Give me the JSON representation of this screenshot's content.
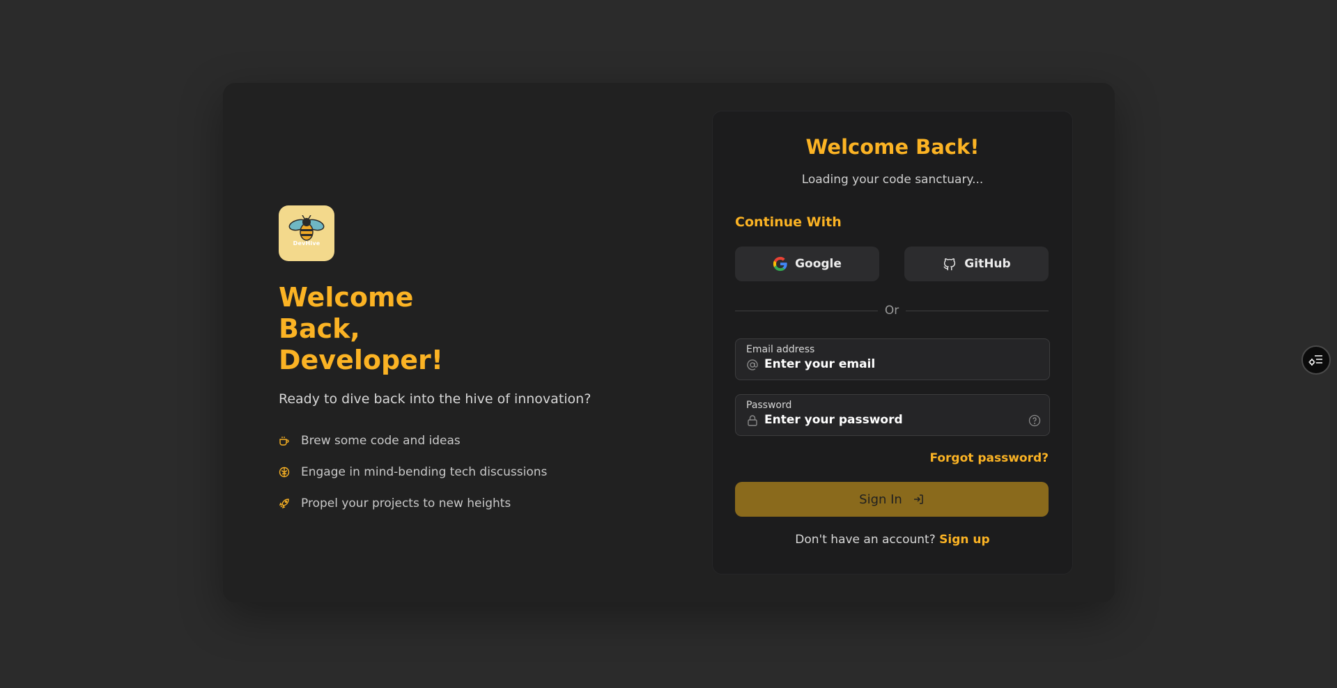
{
  "brand": {
    "logo_text": "DevHive"
  },
  "hero": {
    "title": "Welcome Back, Developer!",
    "subtitle": "Ready to dive back into the hive of innovation?",
    "features": [
      {
        "icon": "coffee-icon",
        "label": "Brew some code and ideas"
      },
      {
        "icon": "brain-icon",
        "label": "Engage in mind-bending tech discussions"
      },
      {
        "icon": "rocket-icon",
        "label": "Propel your projects to new heights"
      }
    ]
  },
  "login": {
    "title": "Welcome Back!",
    "subtitle": "Loading your code sanctuary...",
    "continue_with": "Continue With",
    "google_label": "Google",
    "github_label": "GitHub",
    "divider": "Or",
    "email_label": "Email address",
    "email_placeholder": "Enter your email",
    "password_label": "Password",
    "password_placeholder": "Enter your password",
    "forgot": "Forgot password?",
    "signin": "Sign In",
    "no_account": "Don't have an account?",
    "signup": "Sign up"
  },
  "colors": {
    "accent": "#fbb324",
    "background": "#2b2b2b",
    "card": "#212121"
  }
}
